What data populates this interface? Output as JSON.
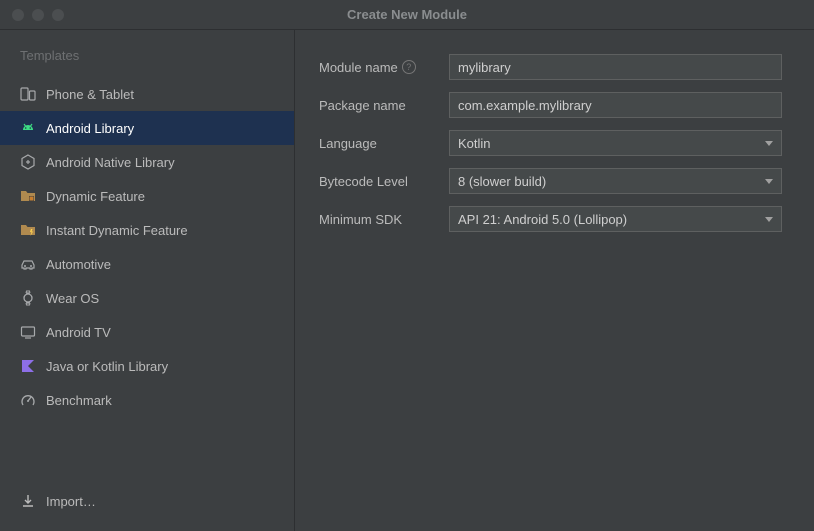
{
  "title": "Create New Module",
  "sidebar": {
    "heading": "Templates",
    "items": [
      {
        "label": "Phone & Tablet"
      },
      {
        "label": "Android Library"
      },
      {
        "label": "Android Native Library"
      },
      {
        "label": "Dynamic Feature"
      },
      {
        "label": "Instant Dynamic Feature"
      },
      {
        "label": "Automotive"
      },
      {
        "label": "Wear OS"
      },
      {
        "label": "Android TV"
      },
      {
        "label": "Java or Kotlin Library"
      },
      {
        "label": "Benchmark"
      }
    ],
    "import_label": "Import…"
  },
  "form": {
    "module_name_label": "Module name",
    "module_name_value": "mylibrary",
    "package_name_label": "Package name",
    "package_name_value": "com.example.mylibrary",
    "language_label": "Language",
    "language_value": "Kotlin",
    "bytecode_label": "Bytecode Level",
    "bytecode_value": "8 (slower build)",
    "min_sdk_label": "Minimum SDK",
    "min_sdk_value": "API 21: Android 5.0 (Lollipop)"
  }
}
